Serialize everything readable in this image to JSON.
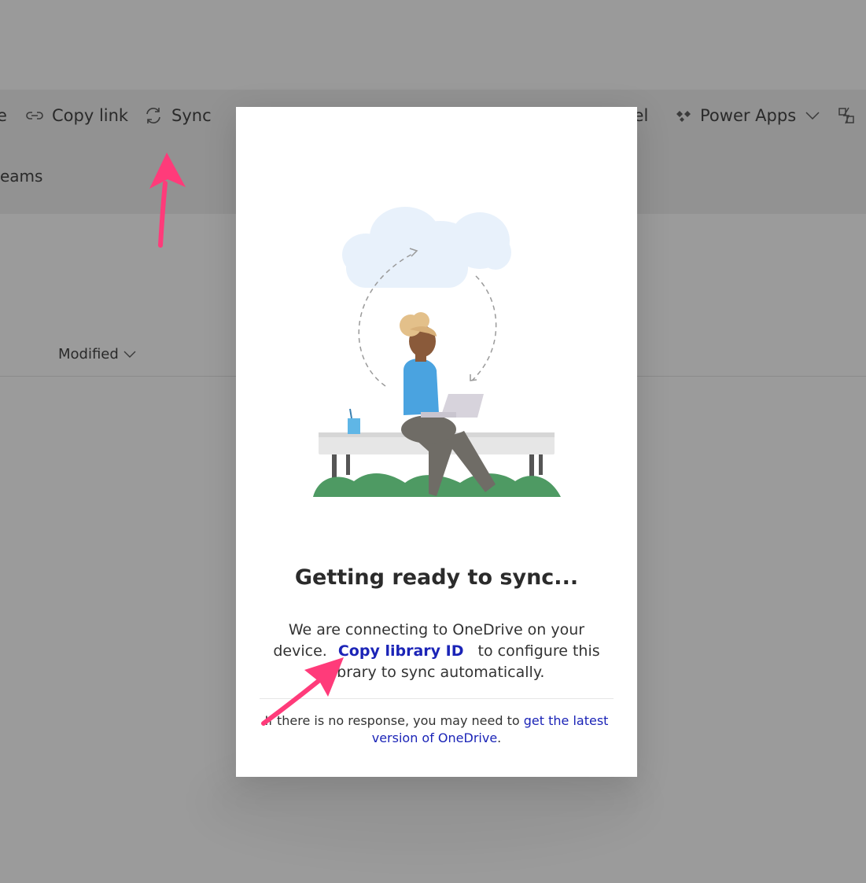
{
  "toolbar": {
    "share_partial": "e",
    "copy_link": "Copy link",
    "sync": "Sync",
    "excel_partial": "cel",
    "power_apps": "Power Apps",
    "teams_partial": "eams"
  },
  "list": {
    "modified_header": "Modified"
  },
  "dialog": {
    "title": "Getting ready to sync...",
    "body_before": "We are connecting to OneDrive on your device.",
    "copy_link_label": "Copy library ID",
    "body_after": "to configure this library to sync automatically.",
    "foot_before": "If there is no response, you may need to",
    "foot_link": "get the latest version of OneDrive",
    "foot_after": "."
  },
  "icons": {
    "copy_link": "link-icon",
    "sync": "sync-icon",
    "power_apps": "power-apps-icon",
    "power_automate": "power-automate-icon",
    "chevron": "chevron-down-icon"
  },
  "colors": {
    "link": "#1b24b7",
    "arrow": "#ff3b7a",
    "cloud": "#e8f1fb",
    "grass": "#4e9a63",
    "shirt": "#4aa3e0"
  }
}
